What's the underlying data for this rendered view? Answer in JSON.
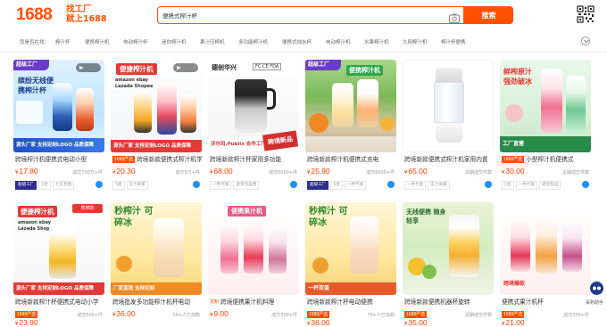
{
  "header": {
    "logo": "1688",
    "slogan_line1": "找工厂",
    "slogan_line2": "就上1688",
    "search_value": "便携式榨汁杯",
    "search_button": "搜索"
  },
  "categories": {
    "label": "您是否在找：",
    "items": [
      "榨汁杯",
      "便携榨汁机",
      "电动榨汁杯",
      "迷你榨汁机",
      "果汁压榨机",
      "多功能榨汁机",
      "便携式炖水杯",
      "电动榨汁机",
      "水果榨汁机",
      "九阳榨汁机",
      "榨汁杯便携"
    ]
  },
  "products": [
    {
      "title": "跨境榨汁机便携式电动小型",
      "price": "17.80",
      "sales": "成交700万+件",
      "tags": [
        "超级工厂",
        "5星",
        "七天包换"
      ],
      "img_banner": "超级工厂",
      "img_headline": "缤纷无线便携榨汁杯",
      "img_footer": "源头厂家 支持定制LOGO 品质保障"
    },
    {
      "title": "跨境新款便携式榨汁机学",
      "price": "20.30",
      "sales": "成交5万+件",
      "tags": [
        "5星",
        "实力商家"
      ],
      "badge": "1688严选",
      "img_headline": "便捷榨汁机",
      "img_footer": "源头厂家 支持定制LOGO 品质保障"
    },
    {
      "title": "跨境新款榨汁杯家用多功能",
      "price": "68.00",
      "sales": "成交5000+件",
      "tags": [
        "一件代发",
        "退货包运费"
      ],
      "img_headline": "德创华兴",
      "img_footer": "沃尔玛.Publix 合作工厂",
      "img_badge": "跨境新品"
    },
    {
      "title": "跨境新款榨汁机便携式充电",
      "price": "25.90",
      "sales": "成交6000+件",
      "tags": [
        "超级工厂",
        "5星",
        "一件代发"
      ],
      "img_banner": "超级工厂",
      "img_headline": "便携榨汁机"
    },
    {
      "title": "跨境新款便携式榨汁机家用内置",
      "price": "65.00",
      "sales": "近期成交件数",
      "tags": [
        "一件代发",
        "实力商家"
      ]
    },
    {
      "title": "小型榨汁机便携式",
      "price": "30.00",
      "sales": "近期成交件数",
      "badge": "1688严选",
      "tags": [
        "5星",
        "一件代发",
        "退货包运"
      ],
      "img_headline": "鲜榨原汁 强劲破冰",
      "img_footer": "工厂直营"
    },
    {
      "title": "跨境新款榨汁杯便携式电动小学",
      "price": "23.90",
      "sales": "成交500+件",
      "badge": "1688严选",
      "tags": [],
      "img_headline": "便捷榨汁机",
      "img_footer": "源头厂家 支持定制LOGO 品质保障"
    },
    {
      "title": "跨境批发多功能榨汁机杯电动",
      "price": "36.00",
      "sales": "50+人已加购",
      "tags": [],
      "img_headline": "秒榨汁 可碎冰",
      "img_footer": "厂家直销 支持定制"
    },
    {
      "title": "跨境便携果汁机料理",
      "price": "9.00",
      "sales": "成交300+件",
      "badge_text": "定制",
      "tags": [],
      "img_headline": "便携果汁机"
    },
    {
      "title": "跨境新款榨汁杯电动便携",
      "price": "36.00",
      "sales": "70+人已加购",
      "badge": "1688严选",
      "tags": [],
      "img_headline": "秒榨汁 可碎冰",
      "img_footer": "一杯双盖"
    },
    {
      "title": "跨境新款便携机器杯旋转",
      "price": "35.00",
      "sales": "近期成交件数",
      "badge": "1688严选",
      "tags": [],
      "img_headline": "无线便携 随身轻享"
    },
    {
      "title": "便携式果汁机杯",
      "price": "21.00",
      "sales": "成交300+件",
      "badge": "1688严选",
      "tags": [],
      "img_footer": "跨境爆款"
    }
  ],
  "float_tool": {
    "label": "采购助手"
  },
  "colors": {
    "brand": "#ff5000",
    "price": "#ff4000"
  }
}
